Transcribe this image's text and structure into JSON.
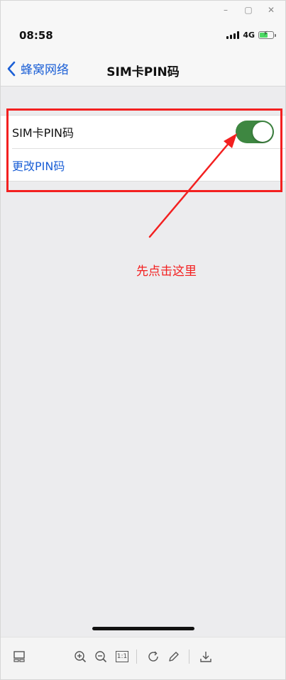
{
  "status_bar": {
    "time": "08:58",
    "network": "4G"
  },
  "navbar": {
    "back_label": "蜂窝网络",
    "title": "SIM卡PIN码"
  },
  "settings": {
    "sim_pin_label": "SIM卡PIN码",
    "sim_pin_enabled": true,
    "change_pin_label": "更改PIN码"
  },
  "annotation": {
    "text": "先点击这里",
    "color": "#f32020"
  },
  "colors": {
    "link": "#1b5fd6",
    "toggle_on": "#3e8741"
  },
  "toolbar": {
    "icons": [
      "thumbnail-icon",
      "zoom-in-icon",
      "zoom-out-icon",
      "actual-size-icon",
      "rotate-icon",
      "edit-icon",
      "download-icon"
    ],
    "actual_size_label": "1:1"
  }
}
